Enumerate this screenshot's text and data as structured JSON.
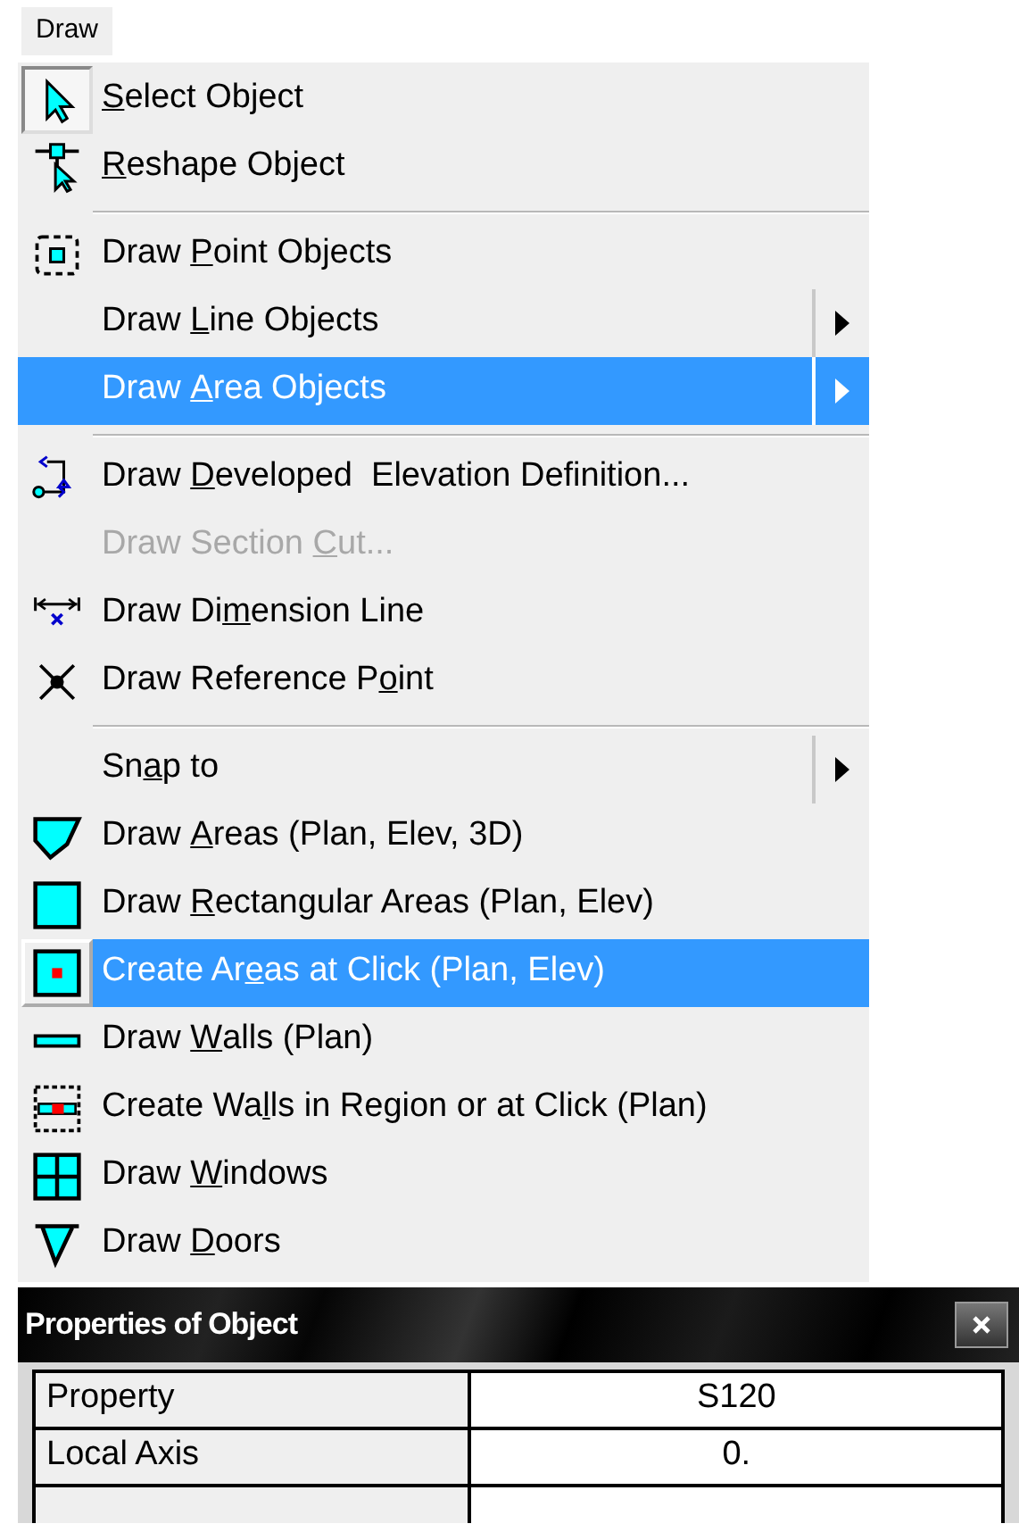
{
  "menu_bar": {
    "title": "Draw"
  },
  "menu": {
    "sections": [
      {
        "items": [
          {
            "access_key": "S",
            "text_after": "elect Object",
            "checked": true,
            "selected": false,
            "disabled": false,
            "submenu": false
          },
          {
            "access_key": "R",
            "text_after": "eshape Object",
            "checked": false,
            "selected": false,
            "disabled": false,
            "submenu": false
          }
        ]
      },
      {
        "items": [
          {
            "text_before": "Draw ",
            "access_key": "P",
            "text_after": "oint Objects",
            "checked": false,
            "selected": false,
            "disabled": false,
            "submenu": false
          },
          {
            "text_before": "Draw ",
            "access_key": "L",
            "text_after": "ine Objects",
            "checked": false,
            "selected": false,
            "disabled": false,
            "submenu": true
          },
          {
            "text_before": "Draw ",
            "access_key": "A",
            "text_after": "rea Objects",
            "checked": false,
            "selected": true,
            "disabled": false,
            "submenu": true
          }
        ]
      },
      {
        "items": [
          {
            "text_before": "Draw ",
            "access_key": "D",
            "text_after": "eveloped  Elevation Definition...",
            "checked": false,
            "selected": false,
            "disabled": false,
            "submenu": false
          },
          {
            "text_before": "Draw Section ",
            "access_key": "C",
            "text_after": "ut...",
            "checked": false,
            "selected": false,
            "disabled": true,
            "submenu": false
          },
          {
            "text_before": "Draw Di",
            "access_key": "m",
            "text_after": "ension Line",
            "checked": false,
            "selected": false,
            "disabled": false,
            "submenu": false
          },
          {
            "text_before": "Draw Reference P",
            "access_key": "o",
            "text_after": "int",
            "checked": false,
            "selected": false,
            "disabled": false,
            "submenu": false
          }
        ]
      },
      {
        "items": [
          {
            "text_before": "Sn",
            "access_key": "a",
            "text_after": "p to",
            "checked": false,
            "selected": false,
            "disabled": false,
            "submenu": true
          },
          {
            "text_before": "Draw ",
            "access_key": "A",
            "text_after": "reas (Plan, Elev, 3D)",
            "checked": false,
            "selected": false,
            "disabled": false,
            "submenu": false
          },
          {
            "text_before": "Draw ",
            "access_key": "R",
            "text_after": "ectangular Areas (Plan, Elev)",
            "checked": false,
            "selected": false,
            "disabled": false,
            "submenu": false
          },
          {
            "text_before": "Create Ar",
            "access_key": "e",
            "text_after": "as at Click (Plan, Elev)",
            "checked": false,
            "selected": true,
            "disabled": false,
            "submenu": false
          },
          {
            "text_before": "Draw ",
            "access_key": "W",
            "text_after": "alls (Plan)",
            "checked": false,
            "selected": false,
            "disabled": false,
            "submenu": false
          },
          {
            "text_before": "Create Wa",
            "access_key": "l",
            "text_after": "ls in Region or at Click (Plan)",
            "checked": false,
            "selected": false,
            "disabled": false,
            "submenu": false
          },
          {
            "text_before": "Draw ",
            "access_key": "W",
            "text_after": "indows",
            "checked": false,
            "selected": false,
            "disabled": false,
            "submenu": false
          },
          {
            "text_before": "Draw ",
            "access_key": "D",
            "text_after": "oors",
            "checked": false,
            "selected": false,
            "disabled": false,
            "submenu": false
          }
        ]
      }
    ]
  },
  "properties_panel": {
    "title": "Properties of Object",
    "rows": [
      {
        "name": "Property",
        "value": "S120"
      },
      {
        "name": "Local Axis",
        "value": "0."
      }
    ]
  }
}
